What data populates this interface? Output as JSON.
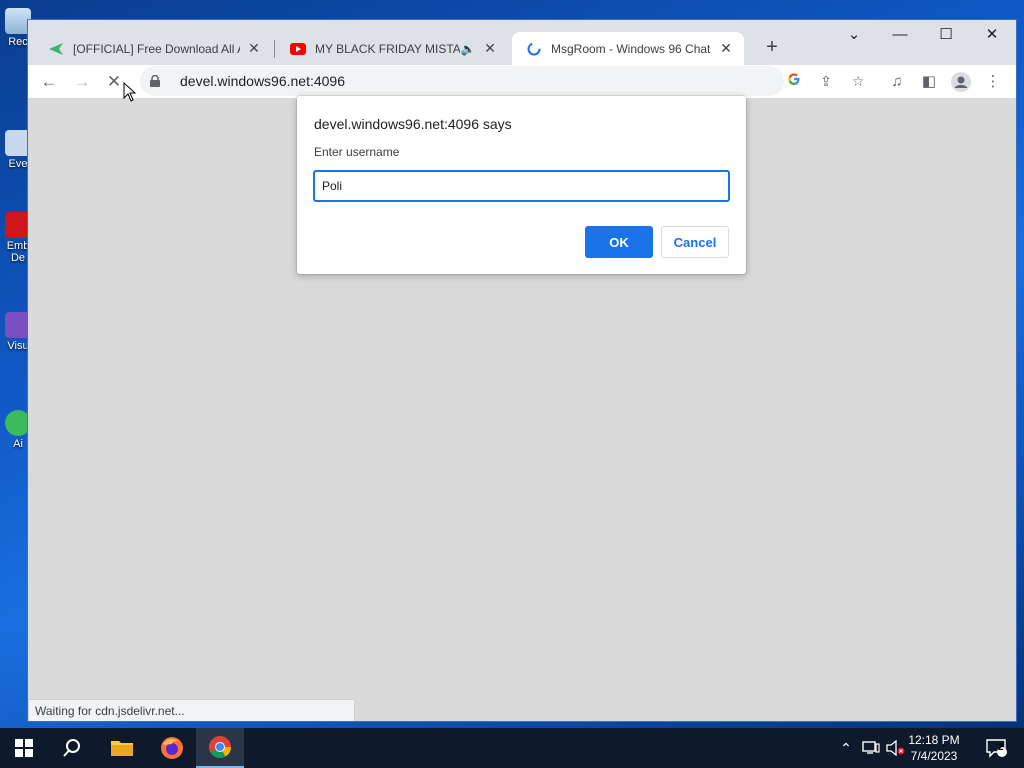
{
  "desktop": {
    "icons": [
      {
        "label": "Rec"
      },
      {
        "label": "Eve"
      },
      {
        "label": "Emb"
      },
      {
        "label": "De"
      },
      {
        "label": "Visu"
      },
      {
        "label": "Ai"
      }
    ]
  },
  "browser": {
    "tabs": [
      {
        "title": "[OFFICIAL] Free Download All Ai",
        "favicon": "bluestacks-icon",
        "active": false
      },
      {
        "title": "MY BLACK FRIDAY MISTAKE",
        "favicon": "youtube-icon",
        "active": false,
        "audio": true
      },
      {
        "title": "MsgRoom - Windows 96 Chat",
        "favicon": "loading-spinner-icon",
        "active": true
      }
    ],
    "url": "devel.windows96.net:4096",
    "status_text": "Waiting for cdn.jsdelivr.net..."
  },
  "dialog": {
    "title": "devel.windows96.net:4096 says",
    "message": "Enter username",
    "input_value": "Poli",
    "ok_label": "OK",
    "cancel_label": "Cancel"
  },
  "taskbar": {
    "time": "12:18 PM",
    "date": "7/4/2023",
    "notification_count": "2"
  },
  "colors": {
    "accent": "#1a73e8",
    "youtube": "#ff0000",
    "taskbar_bg": "#0e1a2b"
  }
}
